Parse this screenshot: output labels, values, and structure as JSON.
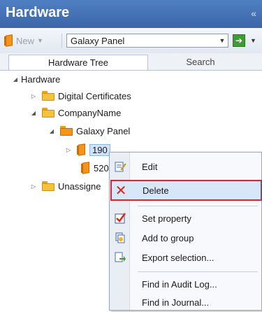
{
  "panel": {
    "title": "Hardware",
    "collapse_glyph": "«"
  },
  "toolbar": {
    "new_label": "New",
    "combo_value": "Galaxy Panel",
    "go_glyph": "➔"
  },
  "tabs": [
    {
      "label": "Hardware Tree",
      "active": true
    },
    {
      "label": "Search",
      "active": false
    }
  ],
  "tree": {
    "root": "Hardware",
    "digital_certificates": "Digital Certificates",
    "company_name": "CompanyName",
    "galaxy_panel": "Galaxy Panel",
    "node_190": "190",
    "node_520": "520",
    "unassigned": "Unassigne"
  },
  "context_menu": {
    "edit": "Edit",
    "delete": "Delete",
    "set_property": "Set property",
    "add_to_group": "Add to group",
    "export_selection": "Export selection...",
    "find_audit": "Find in Audit Log...",
    "find_journal": "Find in Journal..."
  },
  "colors": {
    "title_bar": "#3b66a8",
    "delete_highlight_border": "#e0262d",
    "folder": "#f5c33b",
    "panel_icon": "#f3951b"
  }
}
